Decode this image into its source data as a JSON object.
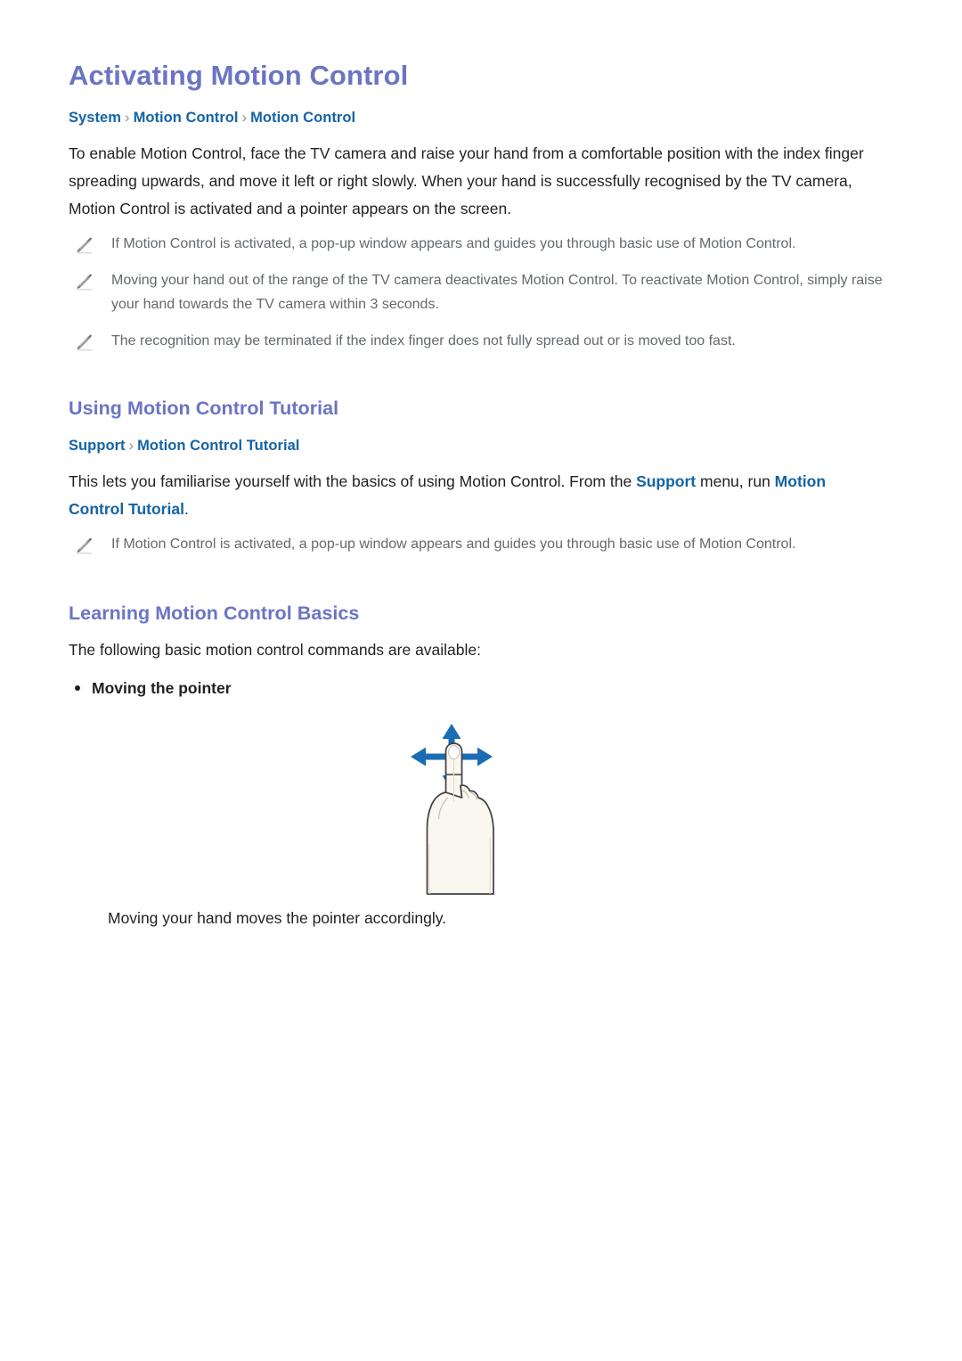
{
  "document": {
    "title": "Activating Motion Control",
    "breadcrumb_1": {
      "item_1": "System",
      "sep_1": "›",
      "item_2": "Motion Control",
      "sep_2": "›",
      "item_3": "Motion Control"
    },
    "intro_paragraph": "To enable Motion Control, face the TV camera and raise your hand from a comfortable position with the index finger spreading upwards, and move it left or right slowly. When your hand is successfully recognised by the TV camera, Motion Control is activated and a pointer appears on the screen.",
    "notes_1": [
      "If Motion Control is activated, a pop-up window appears and guides you through basic use of Motion Control.",
      "Moving your hand out of the range of the TV camera deactivates Motion Control. To reactivate Motion Control, simply raise your hand towards the TV camera within 3 seconds.",
      "The recognition may be terminated if the index finger does not fully spread out or is moved too fast."
    ]
  },
  "section_tutorial": {
    "heading": "Using Motion Control Tutorial",
    "breadcrumb": {
      "item_1": "Support",
      "sep_1": "›",
      "item_2": "Motion Control Tutorial"
    },
    "paragraph_part_1": "This lets you familiarise yourself with the basics of using Motion Control. From the ",
    "paragraph_link_1": "Support",
    "paragraph_part_2": " menu, run ",
    "paragraph_link_2": "Motion Control Tutorial",
    "paragraph_part_3": ".",
    "notes": [
      "If Motion Control is activated, a pop-up window appears and guides you through basic use of Motion Control."
    ]
  },
  "section_basics": {
    "heading": "Learning Motion Control Basics",
    "intro": "The following basic motion control commands are available:",
    "bullet_1": "Moving the pointer",
    "figure_caption": "Moving your hand moves the pointer accordingly.",
    "figure_alt": "hand-pointing-up-with-four-way-arrows"
  },
  "icons": {
    "note_icon": "pencil-icon",
    "bullet_icon": "bullet-dot-icon",
    "breadcrumb_separator_icon": "chevron-right-icon"
  },
  "colors": {
    "heading_purple": "#6b74c4",
    "breadcrumb_blue": "#1464a5",
    "body_black": "#231f20",
    "note_gray": "#63696d",
    "arrow_blue": "#1a6cb5",
    "hand_fill": "#faf6f0",
    "hand_outline": "#3f3f3f"
  }
}
